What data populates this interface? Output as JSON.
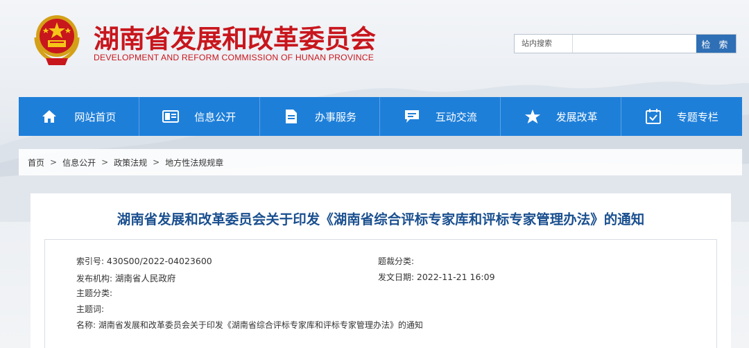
{
  "header": {
    "title": "湖南省发展和改革委员会",
    "subtitle": "DEVELOPMENT AND REFORM COMMISSION OF HUNAN PROVINCE"
  },
  "search": {
    "label": "站内搜索",
    "placeholder": "",
    "button_label": "检 索"
  },
  "nav": {
    "items": [
      {
        "label": "网站首页",
        "icon": "home-icon"
      },
      {
        "label": "信息公开",
        "icon": "id-card-icon"
      },
      {
        "label": "办事服务",
        "icon": "document-icon"
      },
      {
        "label": "互动交流",
        "icon": "chat-icon"
      },
      {
        "label": "发展改革",
        "icon": "star-icon"
      },
      {
        "label": "专题专栏",
        "icon": "calendar-check-icon"
      }
    ]
  },
  "breadcrumb": {
    "items": [
      "首页",
      "信息公开",
      "政策法规",
      "地方性法规规章"
    ],
    "separator": ">"
  },
  "article": {
    "title": "湖南省发展和改革委员会关于印发《湖南省综合评标专家库和评标专家管理办法》的通知",
    "meta": {
      "index_label": "索引号:",
      "index_value": "430S00/2022-04023600",
      "genre_label": "题裁分类:",
      "genre_value": "",
      "publisher_label": "发布机构:",
      "publisher_value": "湖南省人民政府",
      "date_label": "发文日期:",
      "date_value": "2022-11-21 16:09",
      "topic_label": "主题分类:",
      "topic_value": "",
      "keywords_label": "主题词:",
      "keywords_value": "",
      "name_label": "名称:",
      "name_value": "湖南省发展和改革委员会关于印发《湖南省综合评标专家库和评标专家管理办法》的通知"
    }
  },
  "colors": {
    "brand_red": "#c8161d",
    "nav_blue": "#1e7fd9",
    "title_blue": "#1a4f8f",
    "search_button": "#2f6fb5"
  }
}
